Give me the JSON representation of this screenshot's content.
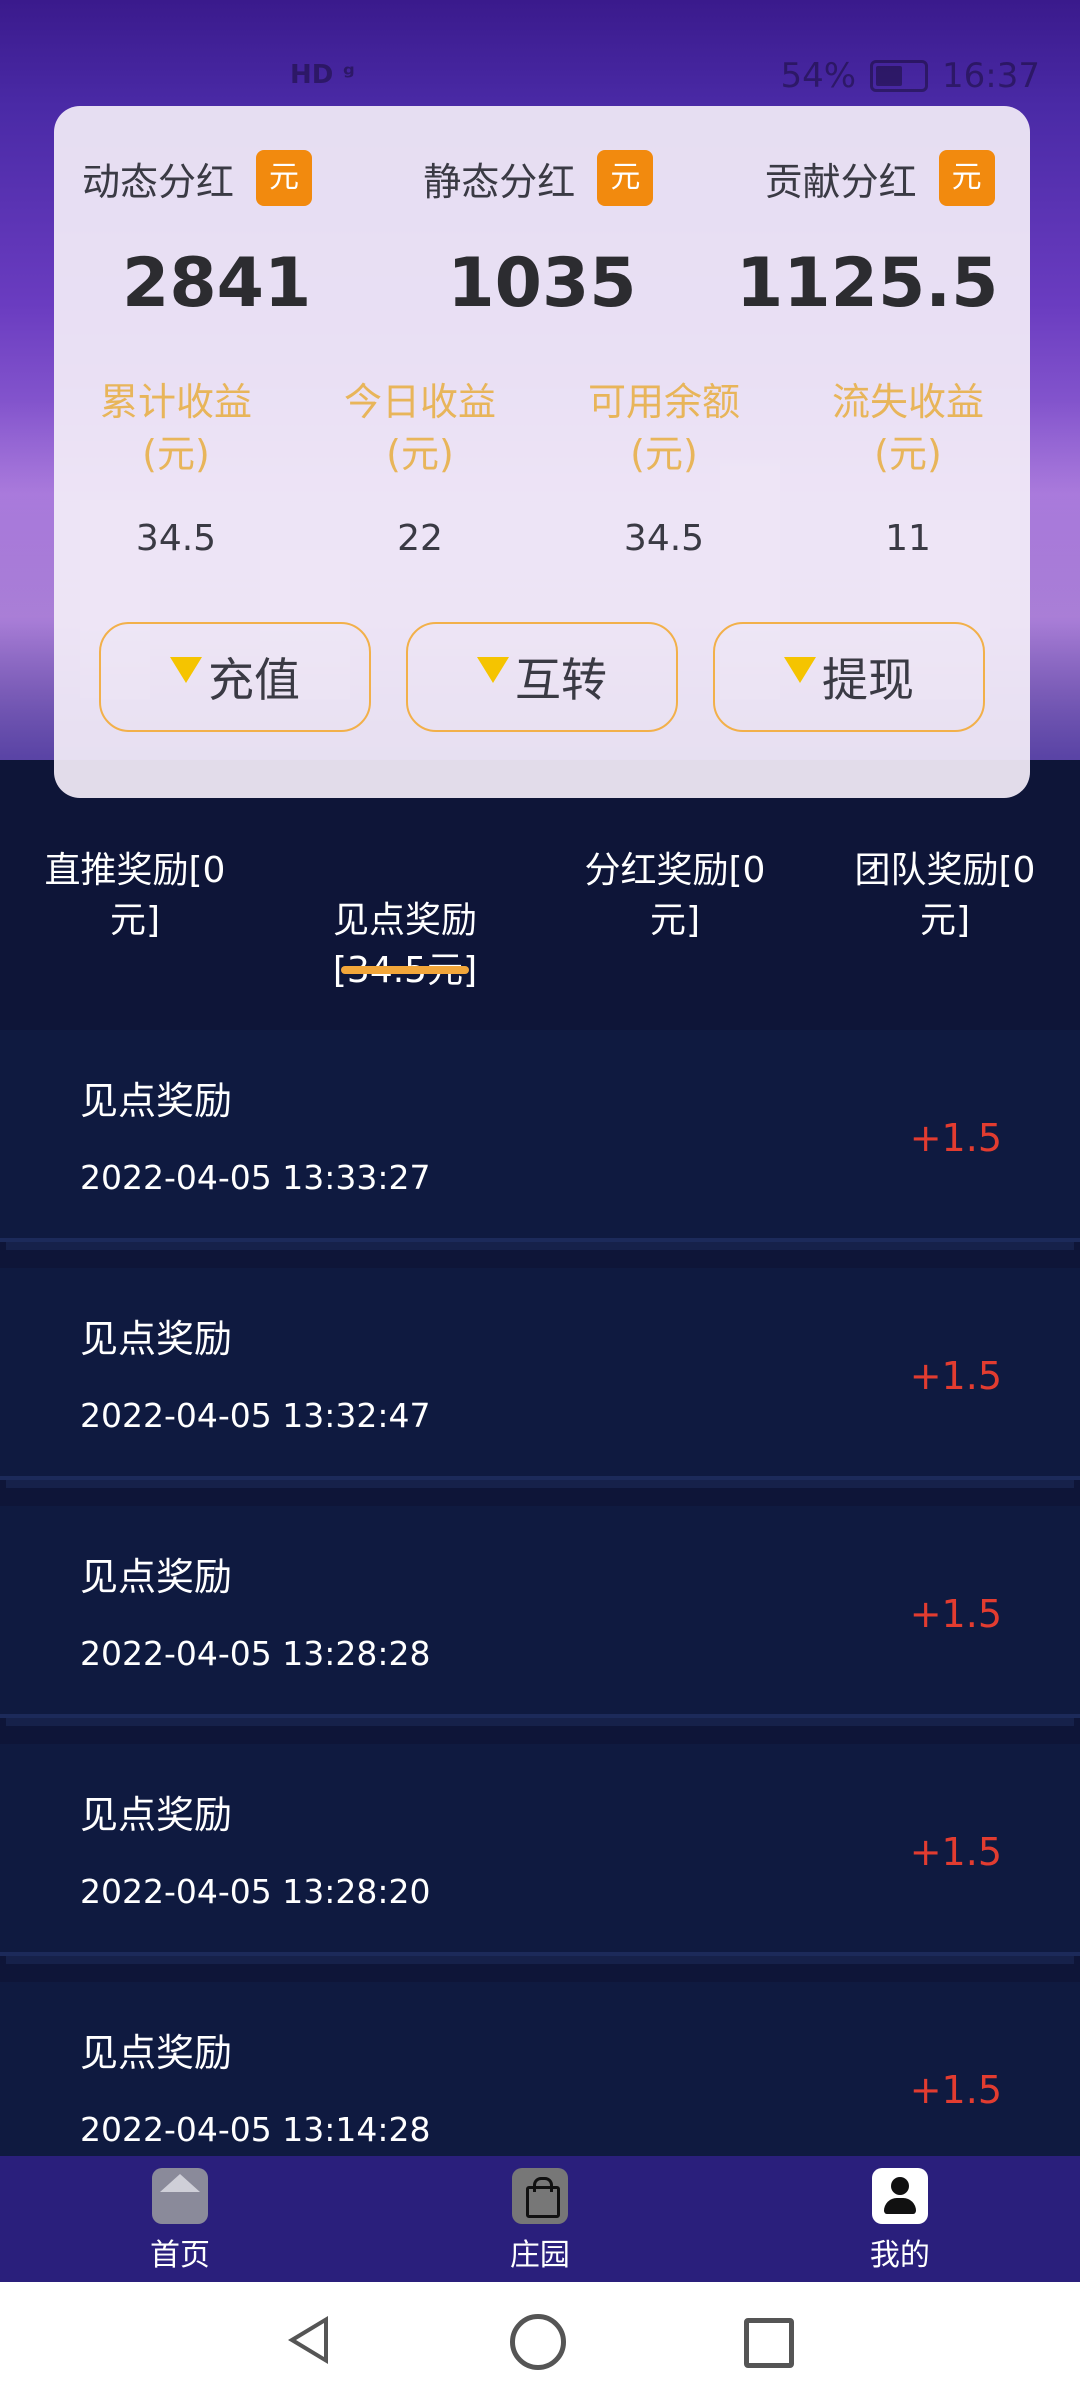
{
  "status_bar": {
    "left": "HD ᵍ",
    "battery": "54%",
    "time": "16:37"
  },
  "summary": [
    {
      "label": "动态分红",
      "badge": "元",
      "value": "2841"
    },
    {
      "label": "静态分红",
      "badge": "元",
      "value": "1035"
    },
    {
      "label": "贡献分红",
      "badge": "元",
      "value": "1125.5"
    }
  ],
  "stats": [
    {
      "label": "累计收益\n(元)",
      "value": "34.5"
    },
    {
      "label": "今日收益\n(元)",
      "value": "22"
    },
    {
      "label": "可用余额\n(元)",
      "value": "34.5"
    },
    {
      "label": "流失收益\n(元)",
      "value": "11"
    }
  ],
  "actions": [
    {
      "label": "充值"
    },
    {
      "label": "互转"
    },
    {
      "label": "提现"
    }
  ],
  "tabs": [
    {
      "label": "直推奖励[0\n元]",
      "active": false
    },
    {
      "label": "见点奖励\n[34.5元]",
      "active": true
    },
    {
      "label": "分红奖励[0\n元]",
      "active": false
    },
    {
      "label": "团队奖励[0\n元]",
      "active": false
    }
  ],
  "records": [
    {
      "title": "见点奖励",
      "time": "2022-04-05 13:33:27",
      "amount": "+1.5"
    },
    {
      "title": "见点奖励",
      "time": "2022-04-05 13:32:47",
      "amount": "+1.5"
    },
    {
      "title": "见点奖励",
      "time": "2022-04-05 13:28:28",
      "amount": "+1.5"
    },
    {
      "title": "见点奖励",
      "time": "2022-04-05 13:28:20",
      "amount": "+1.5"
    },
    {
      "title": "见点奖励",
      "time": "2022-04-05 13:14:28",
      "amount": "+1.5"
    }
  ],
  "bottom_nav": [
    {
      "label": "首页",
      "icon": "home-icon"
    },
    {
      "label": "庄园",
      "icon": "shopping-bag-icon"
    },
    {
      "label": "我的",
      "icon": "profile-icon"
    }
  ],
  "colors": {
    "accent": "#f2a63a",
    "badge": "#f28a0e",
    "amount": "#e23c30",
    "nav_bg": "#2a1f7c"
  }
}
